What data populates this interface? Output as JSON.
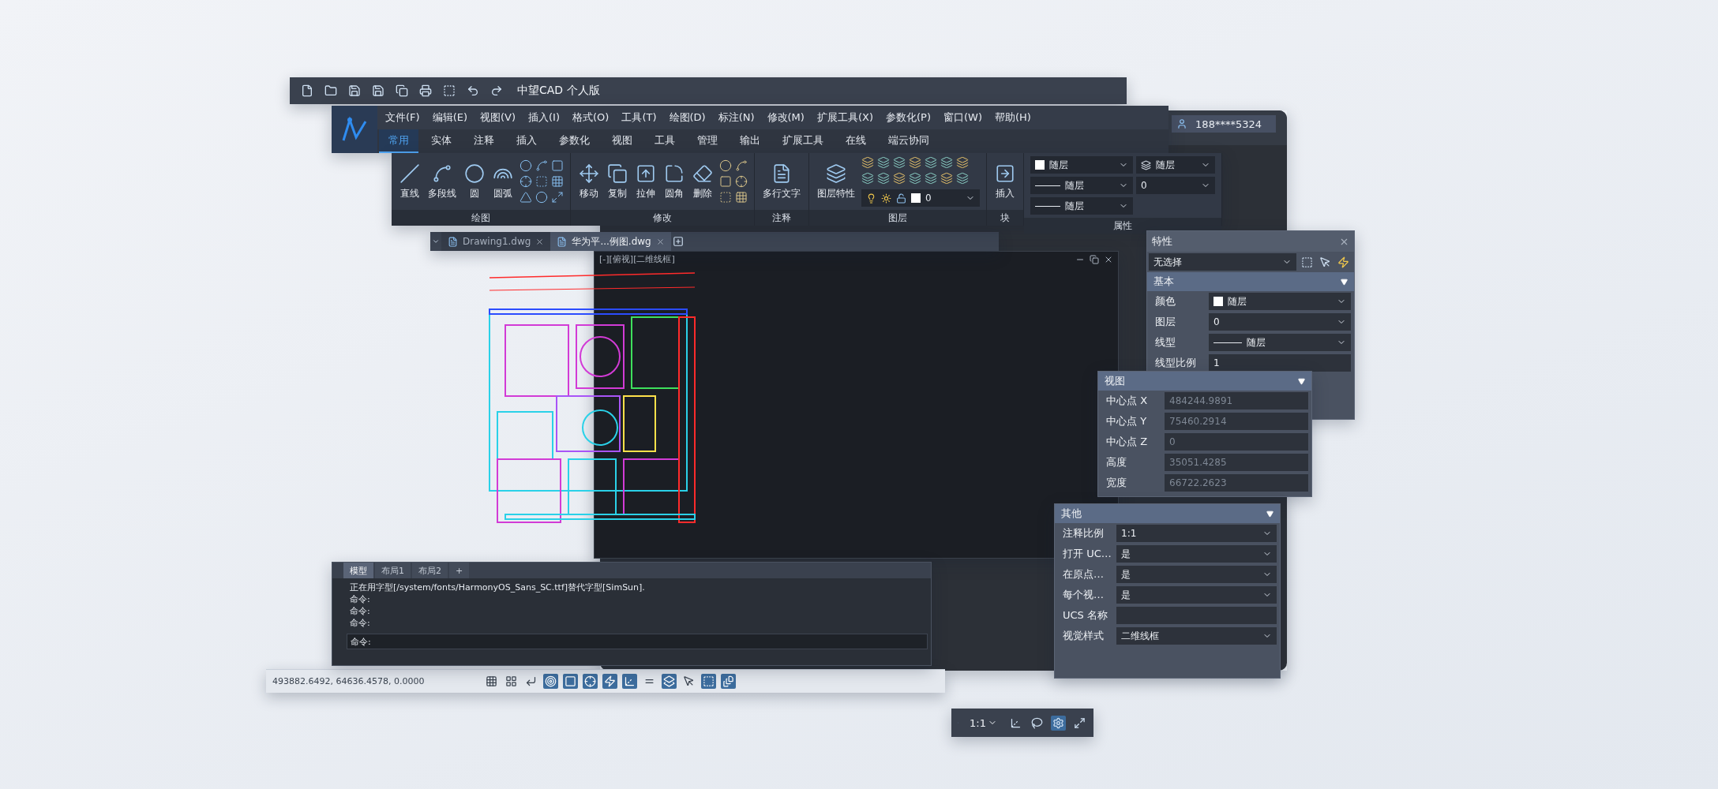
{
  "quick_access": {
    "title": "中望CAD 个人版"
  },
  "menu_bar": [
    "文件(F)",
    "编辑(E)",
    "视图(V)",
    "插入(I)",
    "格式(O)",
    "工具(T)",
    "绘图(D)",
    "标注(N)",
    "修改(M)",
    "扩展工具(X)",
    "参数化(P)",
    "窗口(W)",
    "帮助(H)"
  ],
  "ribbon_tabs": [
    {
      "label": "常用",
      "selected": true
    },
    {
      "label": "实体",
      "selected": false
    },
    {
      "label": "注释",
      "selected": false
    },
    {
      "label": "插入",
      "selected": false
    },
    {
      "label": "参数化",
      "selected": false
    },
    {
      "label": "视图",
      "selected": false
    },
    {
      "label": "工具",
      "selected": false
    },
    {
      "label": "管理",
      "selected": false
    },
    {
      "label": "输出",
      "selected": false
    },
    {
      "label": "扩展工具",
      "selected": false
    },
    {
      "label": "在线",
      "selected": false
    },
    {
      "label": "端云协同",
      "selected": false
    }
  ],
  "ribbon": {
    "groups": [
      {
        "title": "绘图",
        "tools": [
          {
            "label": "直线",
            "kind": "line"
          },
          {
            "label": "多段线",
            "kind": "polyline"
          },
          {
            "label": "圆",
            "kind": "circle"
          },
          {
            "label": "圆弧",
            "kind": "arc"
          }
        ]
      },
      {
        "title": "修改",
        "tools": [
          {
            "label": "移动",
            "kind": "move"
          },
          {
            "label": "复制",
            "kind": "copy"
          },
          {
            "label": "拉伸",
            "kind": "stretch"
          },
          {
            "label": "圆角",
            "kind": "fillet"
          },
          {
            "label": "删除",
            "kind": "erase"
          }
        ]
      },
      {
        "title": "注释",
        "tools": [
          {
            "label": "多行文字",
            "kind": "mtext"
          }
        ]
      },
      {
        "title": "图层",
        "tools": [
          {
            "label": "图层特性",
            "kind": "layer"
          }
        ],
        "current_layer": "0"
      },
      {
        "title": "块",
        "tools": [
          {
            "label": "插入",
            "kind": "insert"
          }
        ]
      },
      {
        "title": "属性",
        "fields": [
          {
            "kind": "color",
            "value": "随层"
          },
          {
            "kind": "line",
            "value": "随层"
          },
          {
            "kind": "line",
            "value": "随层"
          },
          {
            "kind": "stack",
            "value": "随层"
          },
          {
            "kind": "spinner",
            "value": "0"
          }
        ]
      }
    ]
  },
  "user": {
    "account": "188****5324"
  },
  "file_tabs": [
    {
      "label": "Drawing1.dwg",
      "selected": false
    },
    {
      "label": "华为平...例图.dwg",
      "selected": true
    }
  ],
  "viewport": {
    "label": "[-][俯视][二维线框]"
  },
  "properties_panel": {
    "title": "特性",
    "selection": "无选择",
    "section": "基本",
    "rows": [
      {
        "label": "颜色",
        "value": "随层",
        "kind": "color",
        "dropdown": true
      },
      {
        "label": "图层",
        "value": "0",
        "kind": "plain",
        "dropdown": true
      },
      {
        "label": "线型",
        "value": "随层",
        "kind": "line",
        "dropdown": true
      },
      {
        "label": "线型比例",
        "value": "1",
        "kind": "plain",
        "dropdown": false
      }
    ]
  },
  "view_panel": {
    "title": "视图",
    "rows": [
      {
        "label": "中心点 X",
        "value": "484244.9891",
        "disabled": true
      },
      {
        "label": "中心点 Y",
        "value": "75460.2914",
        "disabled": true
      },
      {
        "label": "中心点 Z",
        "value": "0",
        "disabled": true
      },
      {
        "label": "高度",
        "value": "35051.4285",
        "disabled": true
      },
      {
        "label": "宽度",
        "value": "66722.2623",
        "disabled": true
      }
    ]
  },
  "other_panel": {
    "title": "其他",
    "rows": [
      {
        "label": "注释比例",
        "value": "1:1",
        "dropdown": true
      },
      {
        "label": "打开 UC…",
        "value": "是",
        "dropdown": true
      },
      {
        "label": "在原点…",
        "value": "是",
        "dropdown": true
      },
      {
        "label": "每个视…",
        "value": "是",
        "dropdown": true
      },
      {
        "label": "UCS 名称",
        "dropdown": false
      },
      {
        "label": "视觉样式",
        "value": "二维线框",
        "dropdown": true
      }
    ]
  },
  "command_window": {
    "tabs": [
      {
        "label": "模型",
        "selected": true
      },
      {
        "label": "布局1",
        "selected": false
      },
      {
        "label": "布局2",
        "selected": false
      }
    ],
    "add_tab": "+",
    "history": [
      "正在用字型[/system/fonts/HarmonyOS_Sans_SC.ttf]替代字型[SimSun].",
      "命令:",
      "命令:",
      "命令:"
    ],
    "prompt": "命令:"
  },
  "status_bar": {
    "coordinates": "493882.6492, 64636.4578, 0.0000",
    "toggles": [
      {
        "kind": "grid",
        "on": false
      },
      {
        "kind": "snap",
        "on": false
      },
      {
        "kind": "ortho",
        "on": false
      },
      {
        "kind": "polar",
        "on": true
      },
      {
        "kind": "osnap",
        "on": true
      },
      {
        "kind": "otrack",
        "on": true
      },
      {
        "kind": "dyn",
        "on": true
      },
      {
        "kind": "ucs",
        "on": true
      },
      {
        "kind": "weight",
        "on": false
      },
      {
        "kind": "transparency",
        "on": true
      },
      {
        "kind": "cycle",
        "on": false
      },
      {
        "kind": "select",
        "on": true
      },
      {
        "kind": "annotate",
        "on": true
      }
    ]
  },
  "annotation_bar": {
    "scale": "1:1"
  }
}
